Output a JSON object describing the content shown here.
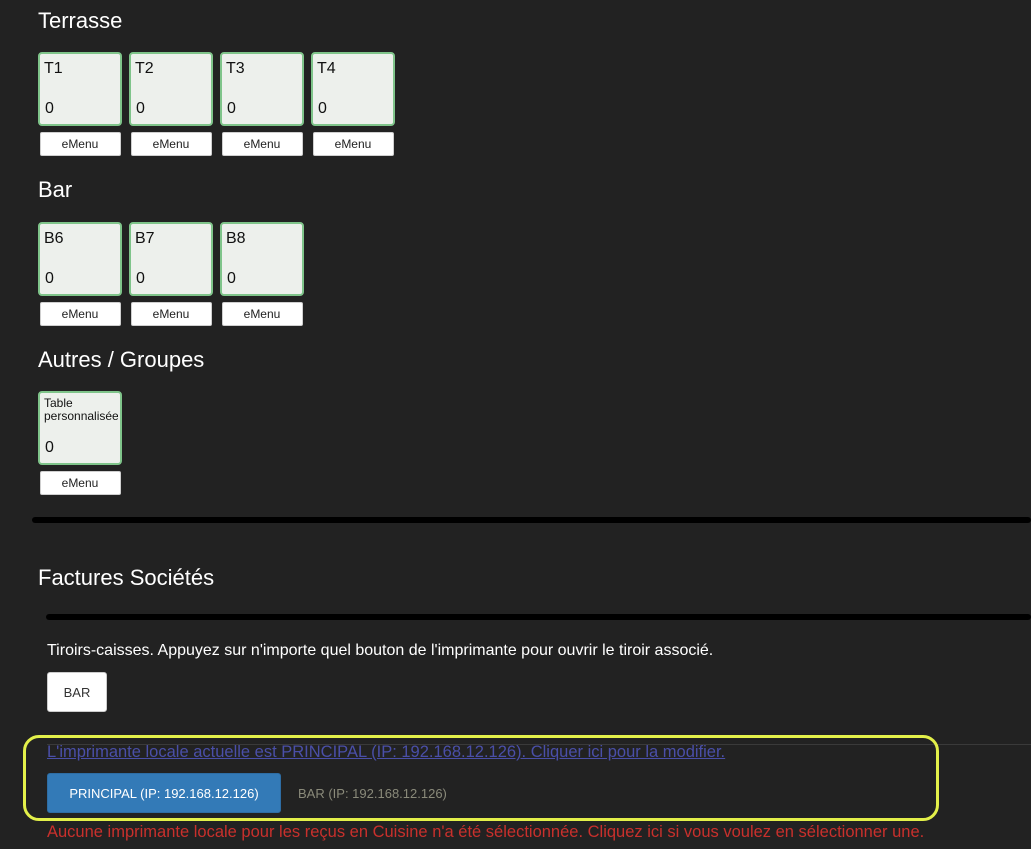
{
  "sections": {
    "terrasse": {
      "title": "Terrasse",
      "tables": [
        {
          "name": "T1",
          "count": "0",
          "emenu": "eMenu"
        },
        {
          "name": "T2",
          "count": "0",
          "emenu": "eMenu"
        },
        {
          "name": "T3",
          "count": "0",
          "emenu": "eMenu"
        },
        {
          "name": "T4",
          "count": "0",
          "emenu": "eMenu"
        }
      ]
    },
    "bar": {
      "title": "Bar",
      "tables": [
        {
          "name": "B6",
          "count": "0",
          "emenu": "eMenu"
        },
        {
          "name": "B7",
          "count": "0",
          "emenu": "eMenu"
        },
        {
          "name": "B8",
          "count": "0",
          "emenu": "eMenu"
        }
      ]
    },
    "autres": {
      "title": "Autres / Groupes",
      "tables": [
        {
          "name": "Table personnalisée",
          "count": "0",
          "emenu": "eMenu"
        }
      ]
    }
  },
  "factures": {
    "title": "Factures Sociétés"
  },
  "cash_drawers": {
    "text": "Tiroirs-caisses. Appuyez sur n'importe quel bouton de l'imprimante pour ouvrir le tiroir associé.",
    "bar_button": "BAR"
  },
  "printer": {
    "current_link": "L'imprimante locale actuelle est PRINCIPAL (IP: 192.168.12.126). Cliquer ici pour la modifier.",
    "principal_button": "PRINCIPAL (IP: 192.168.12.126)",
    "bar_option": "BAR (IP: 192.168.12.126)",
    "kitchen_warning": "Aucune imprimante locale pour les reçus en Cuisine n'a été sélectionnée. Cliquez ici si vous voulez en sélectionner une."
  },
  "colors": {
    "background": "#222222",
    "card_border": "#7fc48a",
    "primary_button": "#337ab7",
    "warning_text": "#c9302c",
    "highlight": "#e3f04a"
  }
}
